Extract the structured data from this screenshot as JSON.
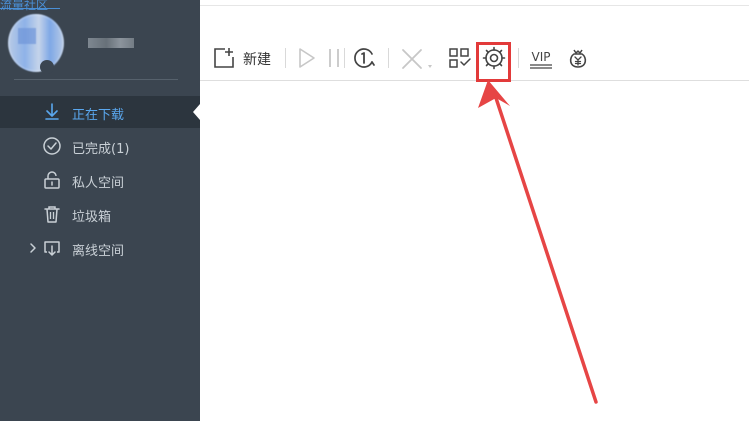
{
  "watermark": "流量社区",
  "sidebar": {
    "items": [
      {
        "label": "正在下载",
        "icon": "download-icon",
        "active": true
      },
      {
        "label": "已完成(1)",
        "icon": "check-circle-icon",
        "active": false
      },
      {
        "label": "私人空间",
        "icon": "lock-icon",
        "active": false
      },
      {
        "label": "垃圾箱",
        "icon": "trash-icon",
        "active": false
      },
      {
        "label": "离线空间",
        "icon": "cloud-download-icon",
        "active": false,
        "expandable": true
      }
    ]
  },
  "toolbar": {
    "new_label": "新建",
    "buttons": [
      {
        "icon": "new-file-icon"
      },
      {
        "icon": "play-icon",
        "enabled": false
      },
      {
        "icon": "pause-icon",
        "enabled": false
      },
      {
        "icon": "speed-limit-icon"
      },
      {
        "icon": "delete-icon",
        "enabled": false
      },
      {
        "icon": "grid-select-icon"
      },
      {
        "icon": "settings-gear-icon",
        "highlighted": true
      },
      {
        "icon": "vip-icon",
        "text": "VIP"
      },
      {
        "icon": "money-bag-icon"
      }
    ]
  },
  "colors": {
    "sidebar_bg": "#3b4550",
    "sidebar_active_bg": "#2c353e",
    "active_text": "#5aa7ee",
    "annotation_red": "#e23a3a"
  }
}
